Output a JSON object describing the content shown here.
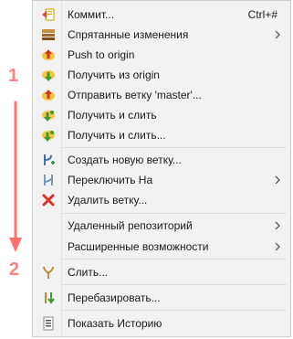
{
  "menu": {
    "items": [
      {
        "label": "Коммит...",
        "shortcut": "Ctrl+#",
        "icon": "commit-icon"
      },
      {
        "label": "Спрятанные изменения",
        "submenu": true,
        "icon": "stash-icon"
      },
      {
        "label": "Push to origin",
        "icon": "push-icon"
      },
      {
        "label": "Получить из origin",
        "icon": "fetch-icon"
      },
      {
        "label": "Отправить ветку 'master'...",
        "icon": "push-branch-icon"
      },
      {
        "label": "Получить и слить",
        "icon": "pull-icon"
      },
      {
        "label": "Получить и слить...",
        "icon": "pull-dialog-icon"
      },
      {
        "label": "Создать новую ветку...",
        "icon": "new-branch-icon"
      },
      {
        "label": "Переключить На",
        "submenu": true,
        "icon": "switch-branch-icon"
      },
      {
        "label": "Удалить ветку...",
        "icon": "delete-icon"
      },
      {
        "label": "Удаленный репозиторий",
        "submenu": true
      },
      {
        "label": "Расширенные возможности",
        "submenu": true
      },
      {
        "label": "Слить...",
        "icon": "merge-icon"
      },
      {
        "label": "Перебазировать...",
        "icon": "rebase-icon"
      },
      {
        "label": "Показать Историю",
        "icon": "history-icon"
      }
    ]
  },
  "annotations": {
    "marker_1": "1",
    "marker_2": "2",
    "accent_color": "#ff7070"
  }
}
